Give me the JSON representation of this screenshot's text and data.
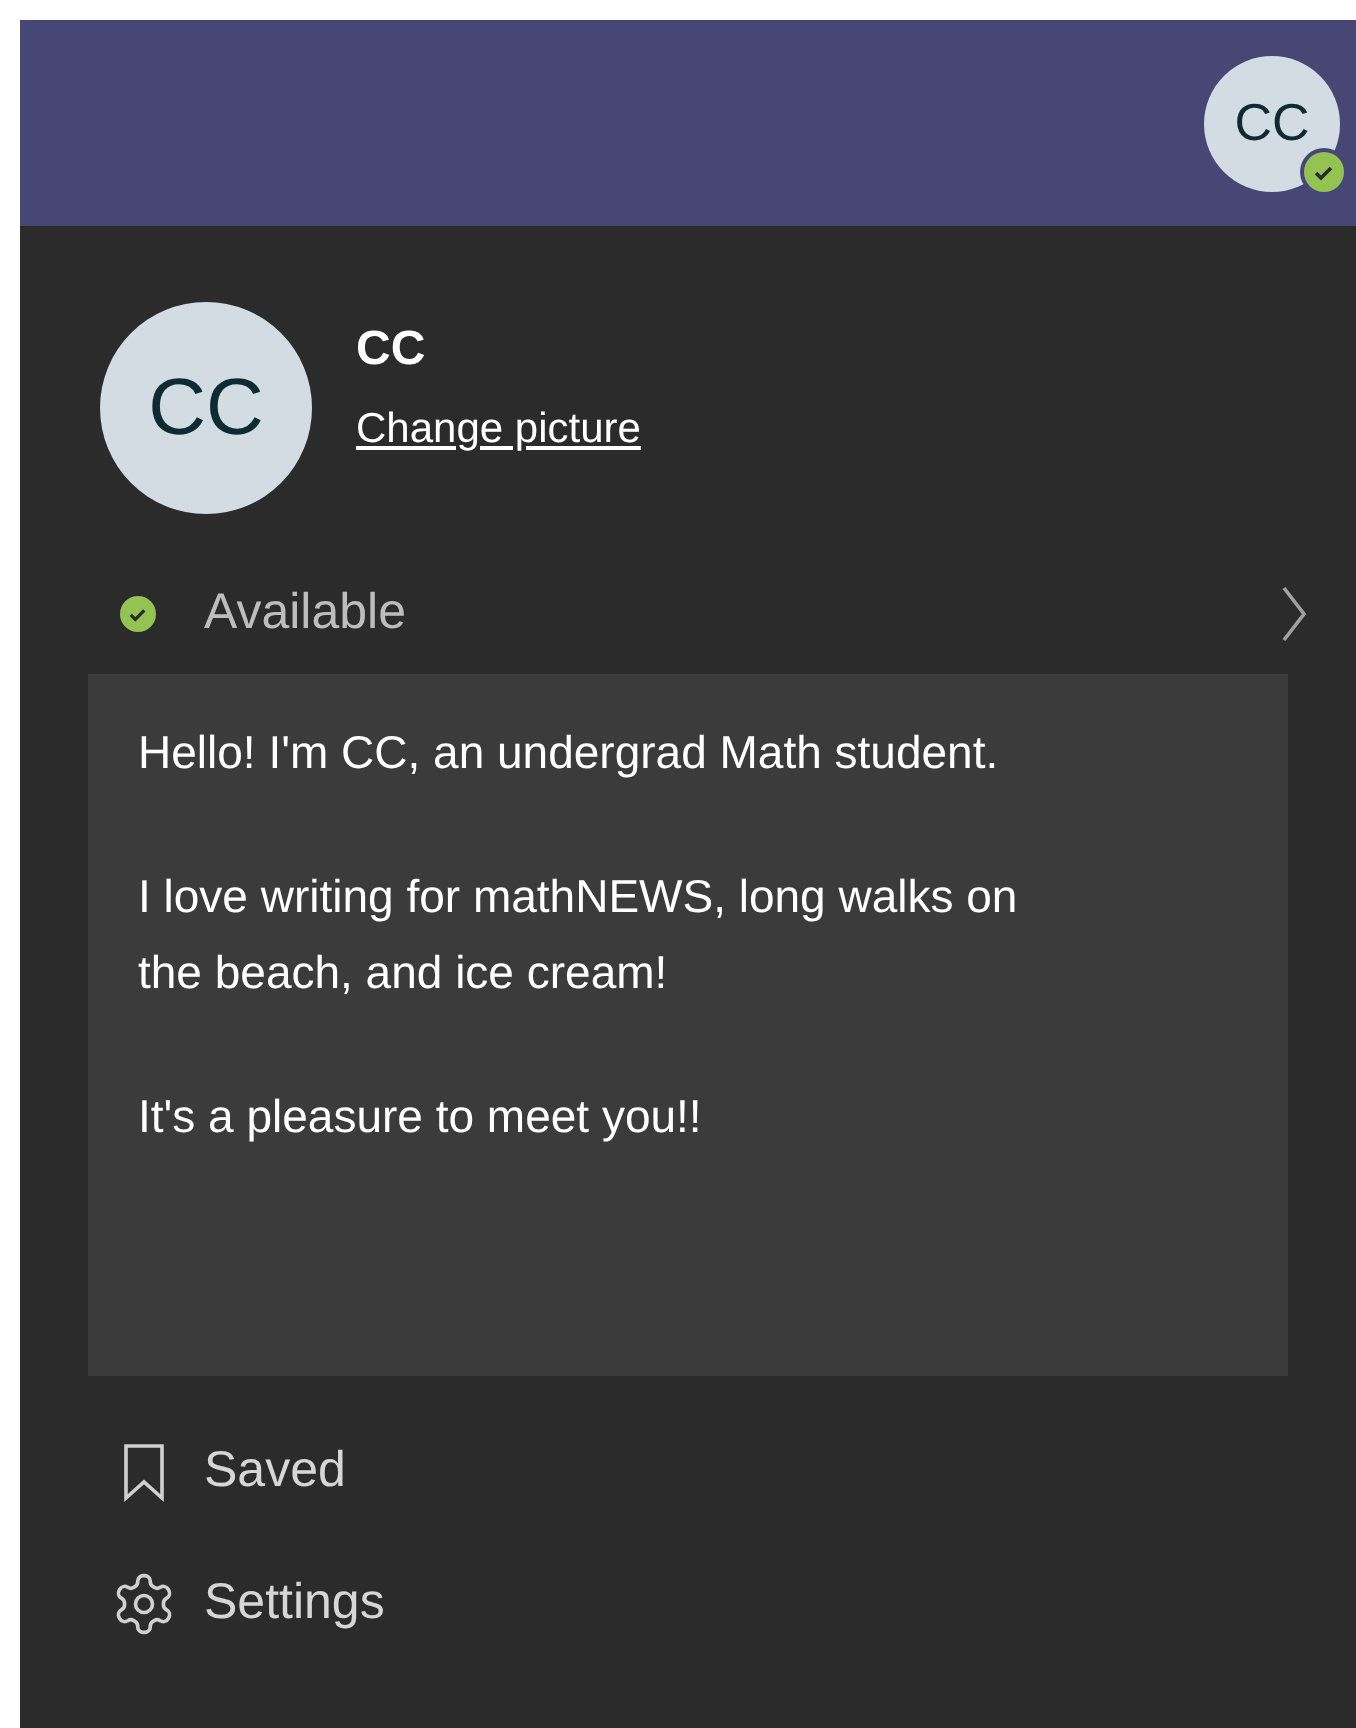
{
  "header": {
    "avatar_initials": "CC",
    "status": {
      "color": "#92c353"
    }
  },
  "profile": {
    "avatar_initials": "CC",
    "name": "CC",
    "change_picture_link": "Change picture"
  },
  "status": {
    "label": "Available",
    "color": "#92c353"
  },
  "bio": [
    "Hello! I'm CC, an undergrad Math student.",
    "I love writing for mathNEWS, long walks on the beach, and ice cream!",
    "It's a pleasure to meet you!!"
  ],
  "menu": [
    {
      "kind": "bookmark",
      "label": "Saved"
    },
    {
      "kind": "settings",
      "label": "Settings"
    }
  ]
}
